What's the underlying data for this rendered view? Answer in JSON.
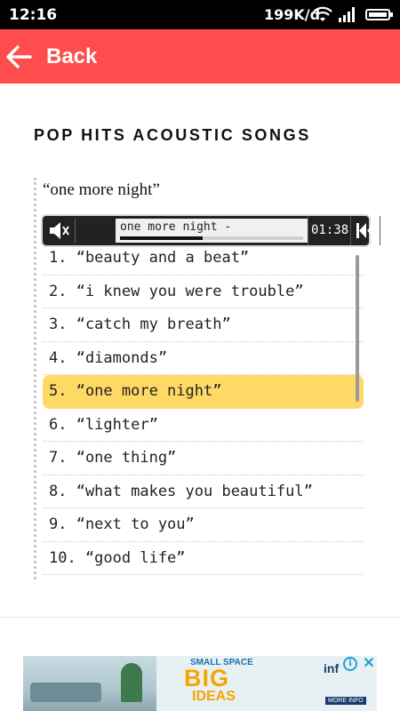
{
  "status_bar": {
    "time": "12:16",
    "network_speed": "199K/d",
    "icons": [
      "wifi-icon",
      "signal-icon",
      "battery-icon"
    ]
  },
  "app_bar": {
    "back_label": "Back",
    "background_color": "#ff4d4d"
  },
  "page": {
    "heading": "POP HITS ACOUSTIC SONGS",
    "now_playing_title": "“one more night”"
  },
  "player": {
    "track_name": "one more night -",
    "elapsed": "01:38",
    "progress_fraction": 0.45,
    "icons": [
      "mute-icon",
      "previous-icon",
      "pause-icon"
    ]
  },
  "playlist": {
    "active_index": 4,
    "active_color": "#ffd966",
    "items": [
      "1. “beauty and a beat”",
      "2. “i knew you were trouble”",
      "3. “catch my breath”",
      "4. “diamonds”",
      "5. “one more night”",
      "6. “lighter”",
      "7. “one thing”",
      "8. “what makes you beautiful”",
      "9. “next to you”",
      "10. “good life”"
    ]
  },
  "ad": {
    "small_text": "SMALL SPACE",
    "big_text": "BIG",
    "ideas_text": "IDEAS",
    "logo_text": "inf",
    "more_text": "MORE INFO",
    "info_glyph": "i",
    "close_glyph": "✕"
  }
}
